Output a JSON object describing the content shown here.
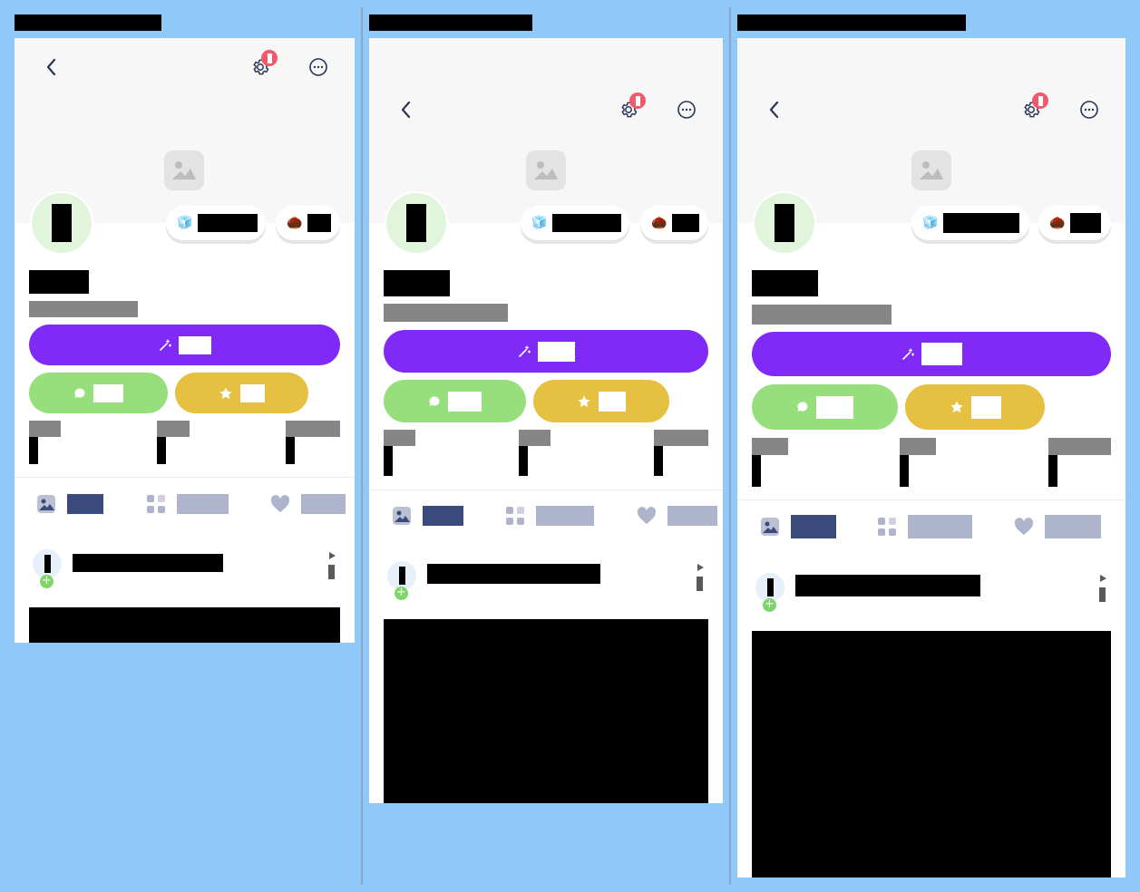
{
  "panels": [
    {
      "label": "",
      "back_label": "Back",
      "settings_badge": "1",
      "name": "",
      "subtitle": "",
      "currencies": [
        {
          "icon": "🧊",
          "value": ""
        },
        {
          "icon": "🌰",
          "value": ""
        }
      ],
      "primary_button": "",
      "chat_button": "",
      "favorite_button": "",
      "stats": [
        {
          "label": "",
          "value": ""
        },
        {
          "label": "",
          "value": ""
        },
        {
          "label": "",
          "value": ""
        }
      ],
      "tabs": [
        {
          "label": "",
          "active": true
        },
        {
          "label": "",
          "active": false
        },
        {
          "label": "",
          "active": false
        }
      ],
      "post": {
        "title": ""
      }
    },
    {
      "label": "",
      "back_label": "Back",
      "settings_badge": "1",
      "name": "",
      "subtitle": "",
      "currencies": [
        {
          "icon": "🧊",
          "value": ""
        },
        {
          "icon": "🌰",
          "value": ""
        }
      ],
      "primary_button": "",
      "chat_button": "",
      "favorite_button": "",
      "stats": [
        {
          "label": "",
          "value": ""
        },
        {
          "label": "",
          "value": ""
        },
        {
          "label": "",
          "value": ""
        }
      ],
      "tabs": [
        {
          "label": "",
          "active": true
        },
        {
          "label": "",
          "active": false
        },
        {
          "label": "",
          "active": false
        }
      ],
      "post": {
        "title": ""
      }
    },
    {
      "label": "",
      "back_label": "Back",
      "settings_badge": "1",
      "name": "",
      "subtitle": "",
      "currencies": [
        {
          "icon": "🧊",
          "value": ""
        },
        {
          "icon": "🌰",
          "value": ""
        }
      ],
      "primary_button": "",
      "chat_button": "",
      "favorite_button": "",
      "stats": [
        {
          "label": "",
          "value": ""
        },
        {
          "label": "",
          "value": ""
        },
        {
          "label": "",
          "value": ""
        }
      ],
      "tabs": [
        {
          "label": "",
          "active": true
        },
        {
          "label": "",
          "active": false
        },
        {
          "label": "",
          "active": false
        }
      ],
      "post": {
        "title": ""
      }
    }
  ],
  "colors": {
    "background": "#90c8f7",
    "primary": "#7f2af6",
    "chat": "#97de7d",
    "favorite": "#e6c040",
    "badge": "#f25a6c",
    "tab_active": "#3b4a7d",
    "tab_inactive": "#adb4cc"
  },
  "icons": {
    "back": "chevron-left-icon",
    "settings": "gear-icon",
    "more": "more-horizontal-icon",
    "cover_placeholder": "image-placeholder-icon",
    "primary": "magic-wand-icon",
    "chat": "chat-bubble-icon",
    "favorite": "star-icon",
    "tab_posts": "image-icon",
    "tab_collections": "grid-icon",
    "tab_likes": "heart-icon",
    "follow": "plus-icon",
    "post_more": "more-vertical-icon"
  }
}
